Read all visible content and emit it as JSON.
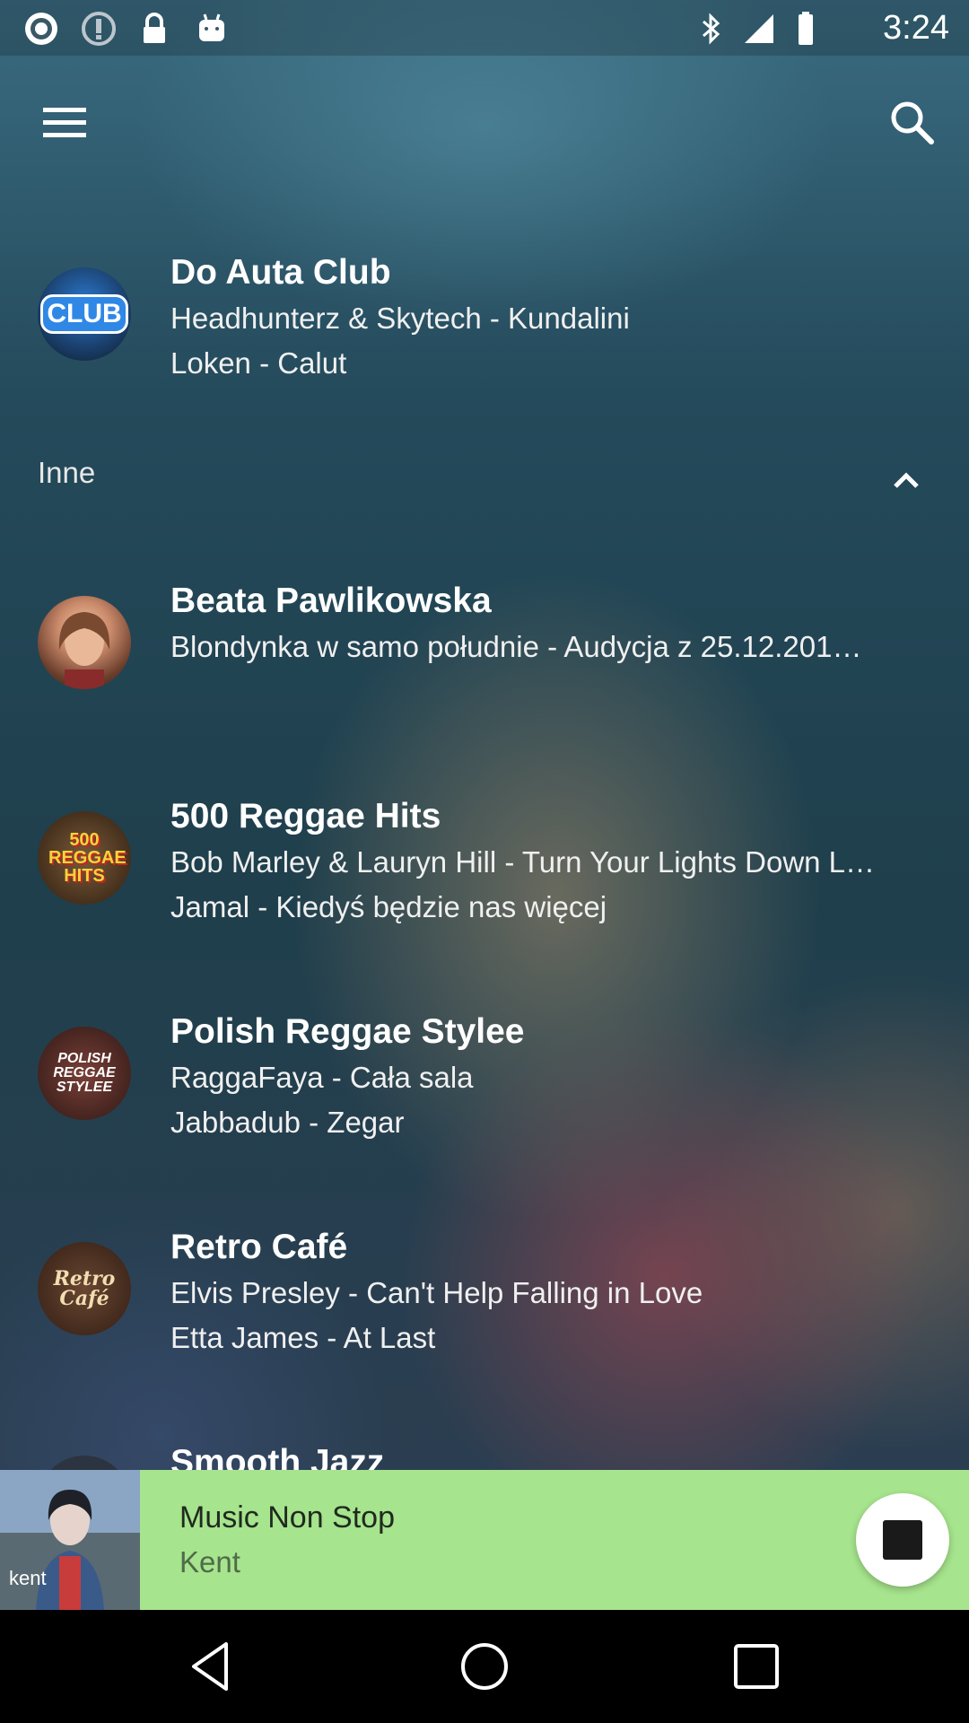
{
  "status_bar": {
    "time": "3:24",
    "icons": [
      "radio-icon",
      "download-paused-icon",
      "lock-icon",
      "android-icon",
      "bluetooth-icon",
      "signal-icon",
      "battery-icon"
    ]
  },
  "app_bar": {
    "menu_icon": "menu-icon",
    "search_icon": "search-icon"
  },
  "favorites": [
    {
      "logo_text": "CLUB",
      "title": "Do Auta Club",
      "lines": [
        "Headhunterz & Skytech - Kundalini",
        "Loken - Calut"
      ]
    }
  ],
  "section": {
    "label": "Inne",
    "toggle_icon": "chevron-up-icon"
  },
  "stations": [
    {
      "logo_text": "",
      "title": "Beata Pawlikowska",
      "lines": [
        "Blondynka w samo południe - Audycja z 25.12.201…"
      ]
    },
    {
      "logo_text": "500 REGGAE HITS",
      "title": "500 Reggae Hits",
      "lines": [
        "Bob Marley & Lauryn Hill - Turn Your Lights Down L…",
        "Jamal - Kiedyś będzie nas więcej"
      ]
    },
    {
      "logo_text": "POLISH REGGAE STYLEE",
      "title": "Polish Reggae Stylee",
      "lines": [
        "RaggaFaya - Cała sala",
        "Jabbadub - Zegar"
      ]
    },
    {
      "logo_text": "Retro Café",
      "title": "Retro Café",
      "lines": [
        "Elvis Presley - Can't Help Falling in Love",
        "Etta James - At Last"
      ]
    },
    {
      "logo_text": "",
      "title": "Smooth Jazz",
      "lines": []
    }
  ],
  "player": {
    "album_text": "kent",
    "title": "Music Non Stop",
    "subtitle": "Kent",
    "button_icon": "stop-icon",
    "background_color": "#a6e48d"
  },
  "nav_bar": {
    "icons": [
      "back-icon",
      "home-icon",
      "recents-icon"
    ]
  }
}
